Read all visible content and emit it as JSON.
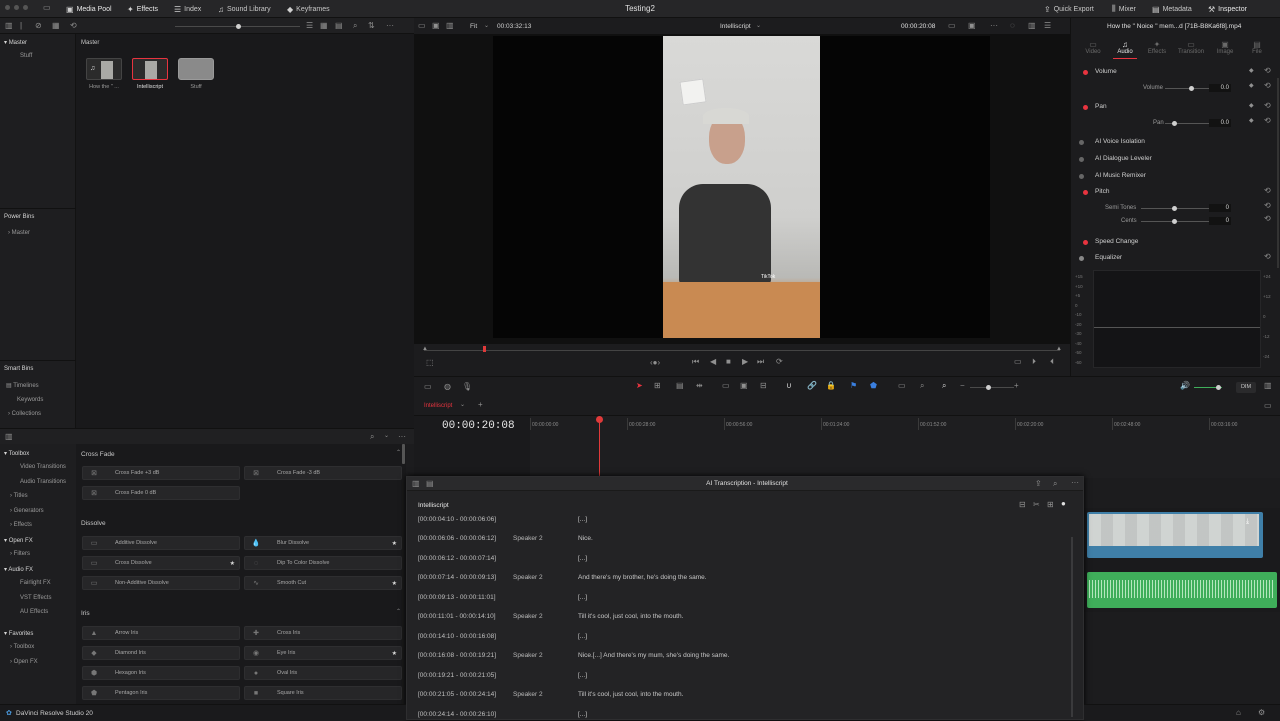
{
  "topbar": {
    "media_pool": "Media Pool",
    "effects": "Effects",
    "index": "Index",
    "sound_library": "Sound Library",
    "keyframes": "Keyframes",
    "project_title": "Testing2",
    "quick_export": "Quick Export",
    "mixer": "Mixer",
    "metadata": "Metadata",
    "inspector": "Inspector"
  },
  "viewer": {
    "zoom": "Fit",
    "source_timecode": "00:03:32:13",
    "timeline_name": "Intelliscript",
    "current_timecode": "00:00:20:08",
    "tiktok_label": "TikTok"
  },
  "inspector": {
    "clip_title": "How the \" Noice \" mem...d [71B-B8Ka6f8].mp4",
    "tabs": [
      "Video",
      "Audio",
      "Effects",
      "Transition",
      "Image",
      "File"
    ],
    "volume": {
      "title": "Volume",
      "label": "Volume",
      "value": "0.0"
    },
    "pan": {
      "title": "Pan",
      "label": "Pan",
      "value": "0.0"
    },
    "ai_voice_isolation": "AI Voice Isolation",
    "ai_dialogue_leveler": "AI Dialogue Leveler",
    "ai_music_remixer": "AI Music Remixer",
    "pitch": {
      "title": "Pitch",
      "semi_tones_label": "Semi Tones",
      "semi_tones_value": "0",
      "cents_label": "Cents",
      "cents_value": "0"
    },
    "speed_change": "Speed Change",
    "equalizer": "Equalizer",
    "eq_left_scale": [
      "+15",
      "+10",
      "+5",
      "0",
      "-10",
      "-20",
      "-30",
      "-40",
      "-50",
      "-60"
    ],
    "eq_right_scale": [
      "+24",
      "+12",
      "0",
      "-12",
      "-24"
    ]
  },
  "media_pool": {
    "bin_header": "Master",
    "clips": [
      {
        "label": "How the \" ..."
      },
      {
        "label": "Intelliscript"
      },
      {
        "label": "Stuff"
      }
    ]
  },
  "left_nav": {
    "master": "Master",
    "stuff": "Stuff",
    "power_bins": "Power Bins",
    "power_master": "Master",
    "smart_bins": "Smart Bins",
    "timelines": "Timelines",
    "keywords": "Keywords",
    "collections": "Collections"
  },
  "toolbox_nav": {
    "toolbox": "Toolbox",
    "video_transitions": "Video Transitions",
    "audio_transitions": "Audio Transitions",
    "titles": "Titles",
    "generators": "Generators",
    "effects": "Effects",
    "open_fx": "Open FX",
    "filters": "Filters",
    "audio_fx": "Audio FX",
    "fairlight_fx": "Fairlight FX",
    "vst_effects": "VST Effects",
    "au_effects": "AU Effects",
    "favorites": "Favorites",
    "fav_toolbox": "Toolbox",
    "fav_open_fx": "Open FX"
  },
  "effects_list": {
    "cross_fade_header": "Cross Fade",
    "cross_fade": [
      "Cross Fade +3 dB",
      "Cross Fade -3 dB",
      "Cross Fade 0 dB"
    ],
    "dissolve_header": "Dissolve",
    "dissolve": [
      "Additive Dissolve",
      "Blur Dissolve",
      "Cross Dissolve",
      "Dip To Color Dissolve",
      "Non-Additive Dissolve",
      "Smooth Cut"
    ],
    "iris_header": "Iris",
    "iris": [
      "Arrow Iris",
      "Cross Iris",
      "Diamond Iris",
      "Eye Iris",
      "Hexagon Iris",
      "Oval Iris",
      "Pentagon Iris",
      "Square Iris"
    ]
  },
  "timeline": {
    "tab_name": "Intelliscript",
    "timecode": "00:00:20:08",
    "ruler": [
      "00:00:00:00",
      "00:00:28:00",
      "00:00:56:00",
      "00:01:24:00",
      "00:01:52:00",
      "00:02:20:00",
      "00:02:48:00",
      "00:03:16:00"
    ]
  },
  "transcript": {
    "title": "AI Transcription - Intelliscript",
    "sub_title": "Intelliscript",
    "rows": [
      {
        "tc": "[00:00:04:10 - 00:00:06:06]",
        "speaker": "",
        "text": "[...]"
      },
      {
        "tc": "[00:00:06:06 - 00:00:06:12]",
        "speaker": "Speaker 2",
        "text": "Nice."
      },
      {
        "tc": "[00:00:06:12 - 00:00:07:14]",
        "speaker": "",
        "text": "[...]"
      },
      {
        "tc": "[00:00:07:14 - 00:00:09:13]",
        "speaker": "Speaker 2",
        "text": "And there's my brother, he's doing the same."
      },
      {
        "tc": "[00:00:09:13 - 00:00:11:01]",
        "speaker": "",
        "text": "[...]"
      },
      {
        "tc": "[00:00:11:01 - 00:00:14:10]",
        "speaker": "Speaker 2",
        "text": "Till it's cool, just cool, into the mouth."
      },
      {
        "tc": "[00:00:14:10 - 00:00:16:08]",
        "speaker": "",
        "text": "[...]"
      },
      {
        "tc": "[00:00:16:08 - 00:00:19:21]",
        "speaker": "Speaker 2",
        "text": "Nice.[...] And there's my mum, she's doing the same."
      },
      {
        "tc": "[00:00:19:21 - 00:00:21:05]",
        "speaker": "",
        "text": "[...]"
      },
      {
        "tc": "[00:00:21:05 - 00:00:24:14]",
        "speaker": "Speaker 2",
        "text": "Till it's cool, just cool, into the mouth."
      },
      {
        "tc": "[00:00:24:14 - 00:00:26:10]",
        "speaker": "",
        "text": "[...]"
      }
    ]
  },
  "status": {
    "app_name": "DaVinci Resolve Studio 20",
    "dim": "DIM"
  },
  "colors": {
    "accent": "#e8343f",
    "playhead": "#e03a3a",
    "video_clip": "#3f7fa8",
    "audio_clip": "#3fae5a"
  }
}
